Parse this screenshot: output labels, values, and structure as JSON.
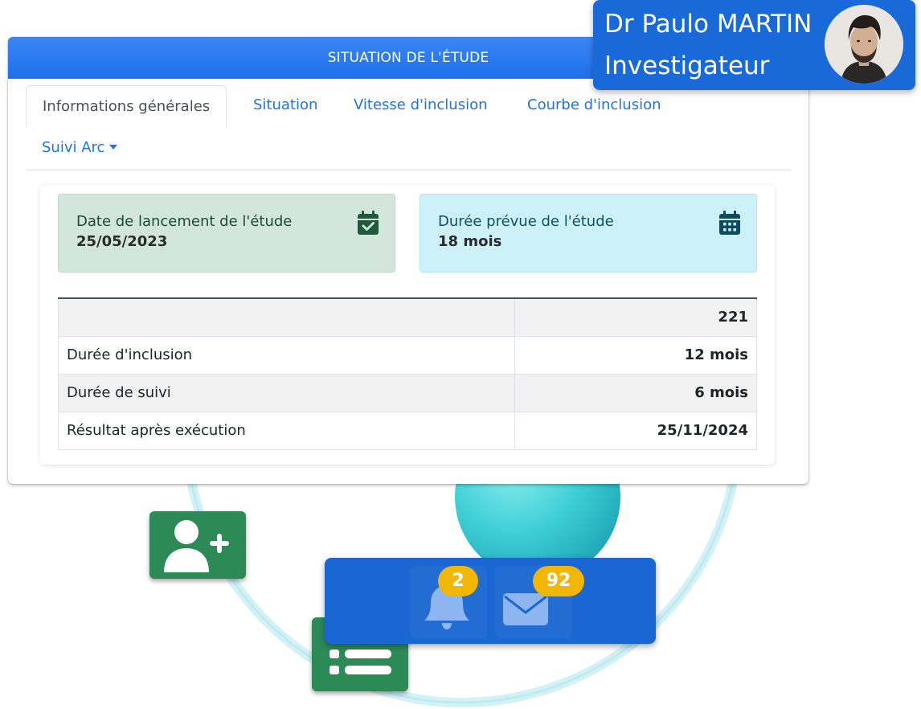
{
  "panel": {
    "title": "SITUATION DE L'ÉTUDE"
  },
  "tabs": [
    {
      "label": "Informations générales",
      "active": true
    },
    {
      "label": "Situation"
    },
    {
      "label": "Vitesse d'inclusion"
    },
    {
      "label": "Courbe d'inclusion"
    },
    {
      "label": "Suivi Arc",
      "dropdown": true
    }
  ],
  "stats": {
    "launch": {
      "label": "Date de lancement de l'étude",
      "value": "25/05/2023",
      "icon": "calendar-check-icon",
      "color": "#d3e6dc"
    },
    "duration": {
      "label": "Durée prévue de l'étude",
      "value": "18 mois",
      "icon": "calendar-days-icon",
      "color": "#cdf1f9"
    }
  },
  "table": {
    "header": {
      "label": "",
      "value": "221"
    },
    "rows": [
      {
        "label": "Durée d'inclusion",
        "value": "12 mois"
      },
      {
        "label": "Durée de suivi",
        "value": "6 mois"
      },
      {
        "label": "Résultat après exécution",
        "value": "25/11/2024"
      }
    ]
  },
  "user": {
    "name": "Dr Paulo MARTIN",
    "role": "Investigateur",
    "avatar_icon": "user-avatar-icon"
  },
  "notifications": {
    "alerts_count": "2",
    "messages_count": "92",
    "bell_icon": "bell-icon",
    "mail_icon": "envelope-icon"
  },
  "colors": {
    "header_blue": "#1d6fea",
    "tile_green": "#2c8a57",
    "badge_yellow": "#f2b705",
    "bar_blue": "#1a66d2"
  }
}
